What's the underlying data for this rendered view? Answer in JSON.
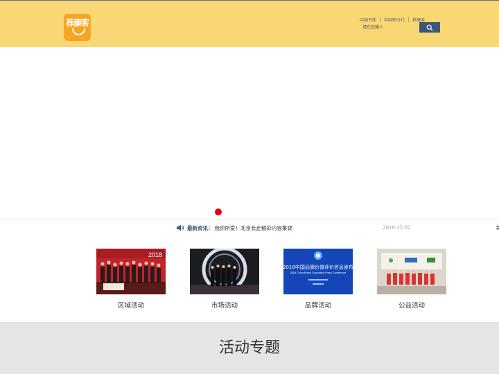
{
  "header": {
    "logo_text": "荐康客",
    "links": [
      "中国节能",
      "中国新时代",
      "荐康客"
    ],
    "search_placeholder": "请在此输入"
  },
  "news": {
    "label": "最新资讯：",
    "headline": "我你所爱！北京长走精彩内容集锦",
    "date": "2019-12-02",
    "next_char": "新"
  },
  "activities": [
    {
      "label": "区域活动"
    },
    {
      "label": "市场活动"
    },
    {
      "label": "品牌活动"
    },
    {
      "label": "公益活动"
    }
  ],
  "tile_texts": {
    "year_badge": "2018",
    "brand_title": "2018中国品牌价值评价信息发布",
    "brand_subtitle": "2018 China Brand Evaluation Press Conference"
  },
  "section": {
    "title": "活动专题"
  },
  "colors": {
    "header_bg": "#f8d774",
    "logo_bg": "#f6a623",
    "search_button": "#3e5677",
    "slider_dot": "#e60012"
  }
}
